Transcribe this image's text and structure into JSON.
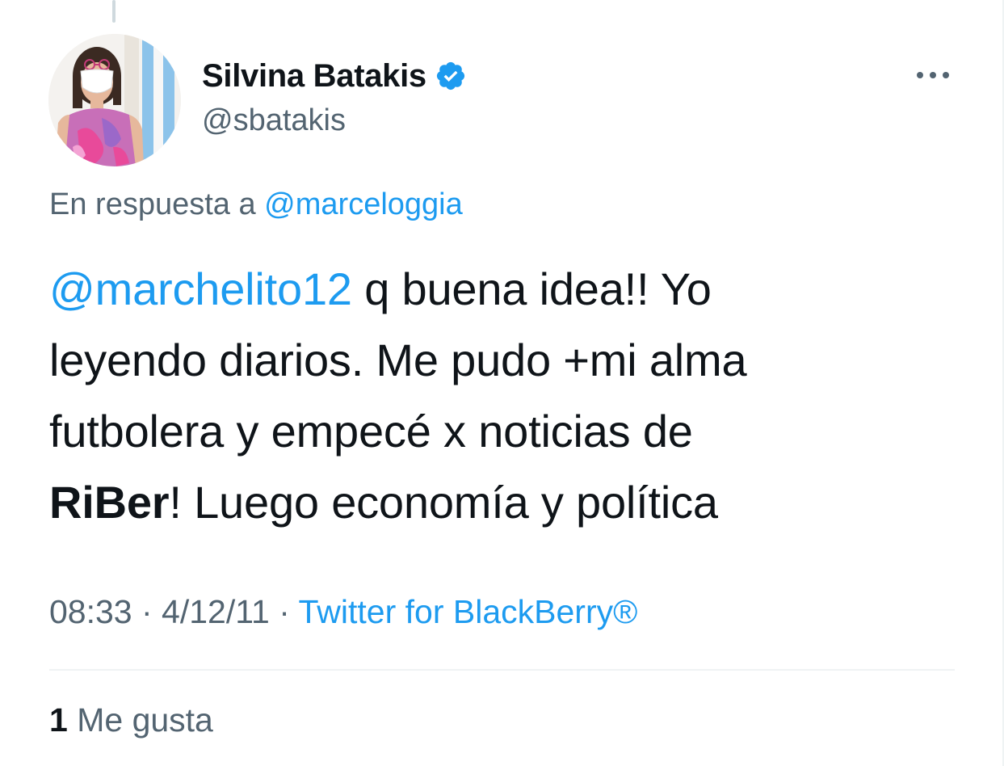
{
  "author": {
    "display_name": "Silvina Batakis",
    "handle": "@sbatakis",
    "verified_icon": "verified-badge",
    "verified_color": "#1d9bf0"
  },
  "menu": {
    "icon": "more-horizontal-icon"
  },
  "reply": {
    "prefix": "En respuesta a",
    "mention": "@marceloggia"
  },
  "tweet": {
    "mention": "@marchelito12",
    "line1_rest": " q buena idea!! Yo",
    "line2": "leyendo diarios. Me pudo +mi alma",
    "line3": "futbolera y empecé x noticias de",
    "line4_bold": "RiBer",
    "line4_rest": "! Luego economía y política"
  },
  "meta": {
    "time": "08:33",
    "sep1": " · ",
    "date": "4/12/11",
    "sep2": " · ",
    "source": "Twitter for BlackBerry®"
  },
  "stats": {
    "likes_count": "1",
    "likes_label": "Me gusta"
  },
  "colors": {
    "link": "#1d9bf0",
    "text": "#0f1419",
    "secondary": "#536471",
    "divider": "#eff3f4"
  }
}
